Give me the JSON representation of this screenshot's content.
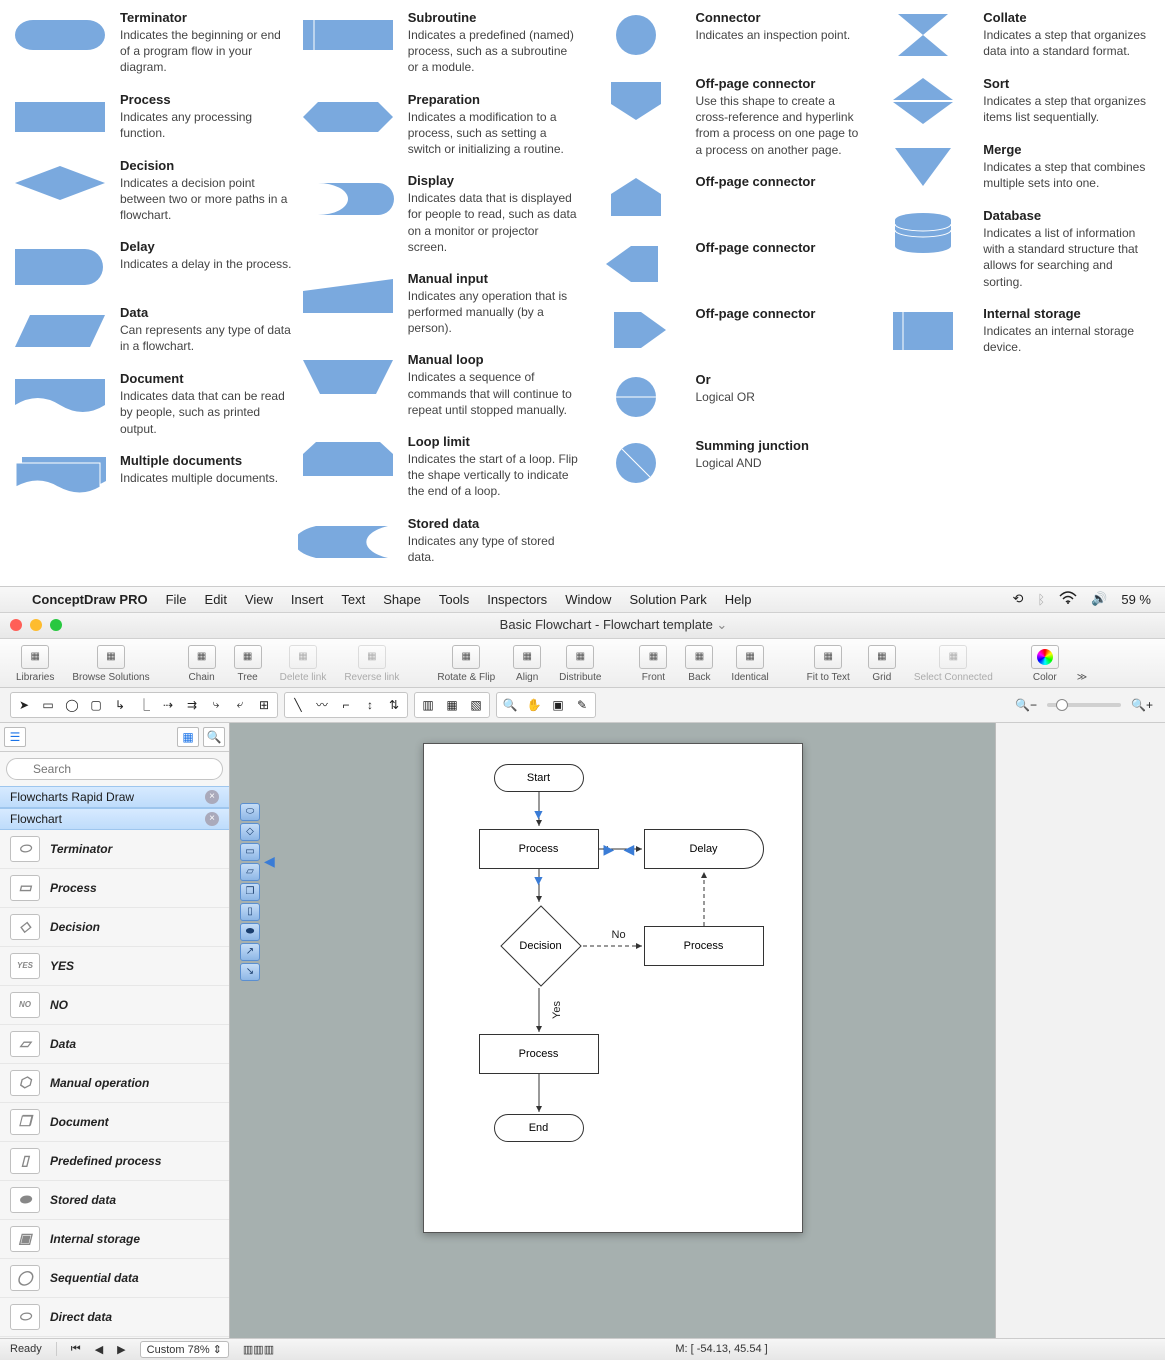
{
  "shapes": {
    "col1": [
      {
        "title": "Terminator",
        "desc": "Indicates the beginning or end of a program flow in your diagram."
      },
      {
        "title": "Process",
        "desc": "Indicates any processing function."
      },
      {
        "title": "Decision",
        "desc": "Indicates a decision point between two or more paths in a flowchart."
      },
      {
        "title": "Delay",
        "desc": "Indicates a delay in the process."
      },
      {
        "title": "Data",
        "desc": "Can represents any type of data in a flowchart."
      },
      {
        "title": "Document",
        "desc": "Indicates data that can be read by people, such as printed output."
      },
      {
        "title": "Multiple documents",
        "desc": "Indicates multiple documents."
      }
    ],
    "col2": [
      {
        "title": "Subroutine",
        "desc": "Indicates a predefined (named) process, such as a subroutine or a module."
      },
      {
        "title": "Preparation",
        "desc": "Indicates a modification to a process, such as setting a switch or initializing a routine."
      },
      {
        "title": "Display",
        "desc": "Indicates data that is displayed for people to read, such as data on a monitor or projector screen."
      },
      {
        "title": "Manual input",
        "desc": "Indicates any operation that is performed manually (by a person)."
      },
      {
        "title": "Manual loop",
        "desc": "Indicates a sequence of commands that will continue to repeat until stopped manually."
      },
      {
        "title": "Loop limit",
        "desc": "Indicates the start of a loop. Flip the shape vertically to indicate the end of a loop."
      },
      {
        "title": "Stored data",
        "desc": "Indicates any type of stored data."
      }
    ],
    "col3": [
      {
        "title": "Connector",
        "desc": "Indicates an inspection point."
      },
      {
        "title": "Off-page connector",
        "desc": "Use this shape to create a cross-reference and hyperlink from a process on one page to a process on another page."
      },
      {
        "title": "Off-page connector",
        "desc": ""
      },
      {
        "title": "Off-page connector",
        "desc": ""
      },
      {
        "title": "Off-page connector",
        "desc": ""
      },
      {
        "title": "Or",
        "desc": "Logical OR"
      },
      {
        "title": "Summing junction",
        "desc": "Logical AND"
      }
    ],
    "col4": [
      {
        "title": "Collate",
        "desc": "Indicates a step that organizes data into a standard format."
      },
      {
        "title": "Sort",
        "desc": "Indicates a step that organizes items list sequentially."
      },
      {
        "title": "Merge",
        "desc": "Indicates a step that combines multiple sets into one."
      },
      {
        "title": "Database",
        "desc": "Indicates a list of information with a standard structure that allows for searching and sorting."
      },
      {
        "title": "Internal storage",
        "desc": "Indicates an internal storage device."
      }
    ]
  },
  "menubar": [
    "File",
    "Edit",
    "View",
    "Insert",
    "Text",
    "Shape",
    "Tools",
    "Inspectors",
    "Window",
    "Solution Park",
    "Help"
  ],
  "appName": "ConceptDraw PRO",
  "battery": "59 %",
  "windowTitle": "Basic Flowchart - Flowchart template",
  "toolbar": [
    {
      "label": "Libraries"
    },
    {
      "label": "Browse Solutions"
    },
    {
      "sep": true
    },
    {
      "label": "Chain"
    },
    {
      "label": "Tree"
    },
    {
      "label": "Delete link",
      "disabled": true
    },
    {
      "label": "Reverse link",
      "disabled": true
    },
    {
      "sep": true
    },
    {
      "label": "Rotate & Flip"
    },
    {
      "label": "Align"
    },
    {
      "label": "Distribute"
    },
    {
      "sep": true
    },
    {
      "label": "Front"
    },
    {
      "label": "Back"
    },
    {
      "label": "Identical"
    },
    {
      "sep": true
    },
    {
      "label": "Fit to Text"
    },
    {
      "label": "Grid"
    },
    {
      "label": "Select Connected",
      "disabled": true
    },
    {
      "sep": true
    },
    {
      "label": "Color"
    }
  ],
  "searchPlaceholder": "Search",
  "sidebarCats": [
    "Flowcharts Rapid Draw",
    "Flowchart"
  ],
  "libItems": [
    "Terminator",
    "Process",
    "Decision",
    "YES",
    "NO",
    "Data",
    "Manual operation",
    "Document",
    "Predefined process",
    "Stored data",
    "Internal storage",
    "Sequential data",
    "Direct data"
  ],
  "canvasNodes": {
    "start": "Start",
    "process": "Process",
    "delay": "Delay",
    "decision": "Decision",
    "process2": "Process",
    "process3": "Process",
    "end": "End",
    "no": "No",
    "yes": "Yes"
  },
  "status": {
    "ready": "Ready",
    "zoom": "Custom 78%",
    "coords": "M: [ -54.13, 45.54 ]"
  }
}
